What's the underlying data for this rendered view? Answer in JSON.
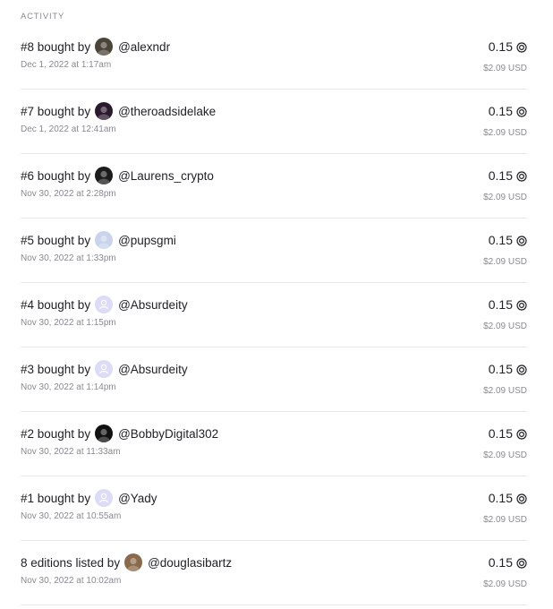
{
  "section_title": "ACTIVITY",
  "icons": {
    "currency": "currency-circle-icon",
    "default_avatar": "user-placeholder-icon"
  },
  "colors": {
    "text_primary": "#1f1f24",
    "text_secondary": "#8a8a93",
    "divider": "#e6e6ea",
    "placeholder_avatar_bg": "#dcdcf7"
  },
  "activity": [
    {
      "action": "#8 bought by",
      "username": "@alexndr",
      "avatar": "photo-avatar",
      "avatar_color": "#4a4538",
      "timestamp": "Dec 1, 2022 at 1:17am",
      "price": "0.15",
      "usd": "$2.09 USD"
    },
    {
      "action": "#7 bought by",
      "username": "@theroadsidelake",
      "avatar": "photo-avatar",
      "avatar_color": "#2b1a2e",
      "timestamp": "Dec 1, 2022 at 12:41am",
      "price": "0.15",
      "usd": "$2.09 USD"
    },
    {
      "action": "#6 bought by",
      "username": "@Laurens_crypto",
      "avatar": "photo-avatar",
      "avatar_color": "#1c1c1c",
      "timestamp": "Nov 30, 2022 at 2:28pm",
      "price": "0.15",
      "usd": "$2.09 USD"
    },
    {
      "action": "#5 bought by",
      "username": "@pupsgmi",
      "avatar": "photo-avatar",
      "avatar_color": "#c9d4ec",
      "timestamp": "Nov 30, 2022 at 1:33pm",
      "price": "0.15",
      "usd": "$2.09 USD"
    },
    {
      "action": "#4 bought by",
      "username": "@Absurdeity",
      "avatar": "user-placeholder-icon",
      "avatar_color": "#dcdcf7",
      "timestamp": "Nov 30, 2022 at 1:15pm",
      "price": "0.15",
      "usd": "$2.09 USD"
    },
    {
      "action": "#3 bought by",
      "username": "@Absurdeity",
      "avatar": "user-placeholder-icon",
      "avatar_color": "#dcdcf7",
      "timestamp": "Nov 30, 2022 at 1:14pm",
      "price": "0.15",
      "usd": "$2.09 USD"
    },
    {
      "action": "#2 bought by",
      "username": "@BobbyDigital302",
      "avatar": "photo-avatar",
      "avatar_color": "#111111",
      "timestamp": "Nov 30, 2022 at 11:33am",
      "price": "0.15",
      "usd": "$2.09 USD"
    },
    {
      "action": "#1 bought by",
      "username": "@Yady",
      "avatar": "user-placeholder-icon",
      "avatar_color": "#dcdcf7",
      "timestamp": "Nov 30, 2022 at 10:55am",
      "price": "0.15",
      "usd": "$2.09 USD"
    },
    {
      "action": "8 editions listed by",
      "username": "@douglasibartz",
      "avatar": "photo-avatar",
      "avatar_color": "#8a6a4a",
      "timestamp": "Nov 30, 2022 at 10:02am",
      "price": "0.15",
      "usd": "$2.09 USD"
    }
  ]
}
